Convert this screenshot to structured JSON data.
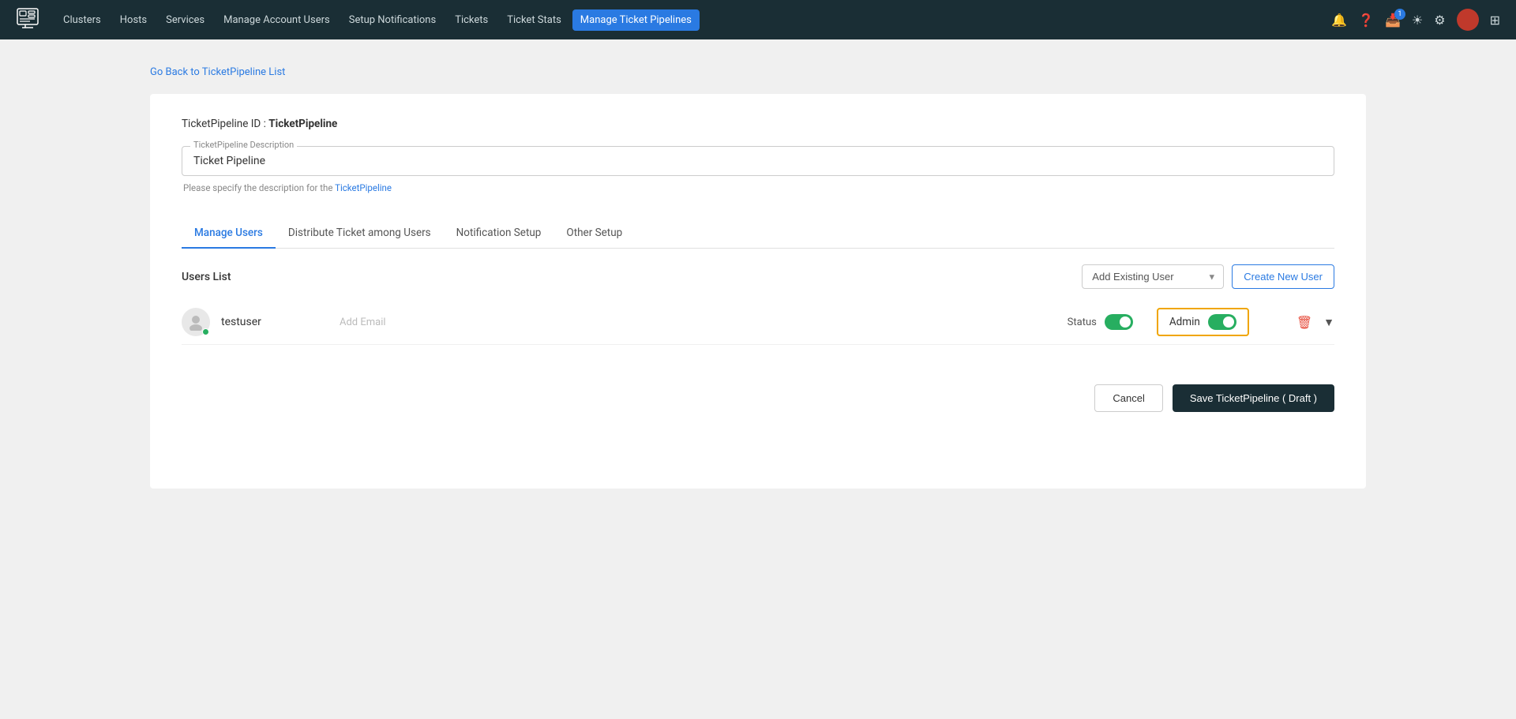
{
  "navbar": {
    "logo": "🖥",
    "items": [
      {
        "label": "Clusters",
        "active": false
      },
      {
        "label": "Hosts",
        "active": false
      },
      {
        "label": "Services",
        "active": false
      },
      {
        "label": "Manage Account Users",
        "active": false
      },
      {
        "label": "Setup Notifications",
        "active": false
      },
      {
        "label": "Tickets",
        "active": false
      },
      {
        "label": "Ticket Stats",
        "active": false
      },
      {
        "label": "Manage Ticket Pipelines",
        "active": true
      }
    ],
    "notification_badge": "1"
  },
  "back_link": "Go Back to TicketPipeline List",
  "pipeline_id_label": "TicketPipeline ID :",
  "pipeline_id_value": "TicketPipeline",
  "description_field_label": "TicketPipeline Description",
  "description_value": "Ticket Pipeline",
  "description_hint": "Please specify the description for the TicketPipeline",
  "tabs": [
    {
      "label": "Manage Users",
      "active": true
    },
    {
      "label": "Distribute Ticket among Users",
      "active": false
    },
    {
      "label": "Notification Setup",
      "active": false
    },
    {
      "label": "Other Setup",
      "active": false
    }
  ],
  "users_list_label": "Users List",
  "add_existing_placeholder": "Add Existing User",
  "create_new_label": "Create New User",
  "users": [
    {
      "name": "testuser",
      "email": "Add Email",
      "status_label": "Status",
      "admin_label": "Admin",
      "status_active": true,
      "admin_active": true
    }
  ],
  "cancel_label": "Cancel",
  "save_label": "Save TicketPipeline ( Draft )"
}
